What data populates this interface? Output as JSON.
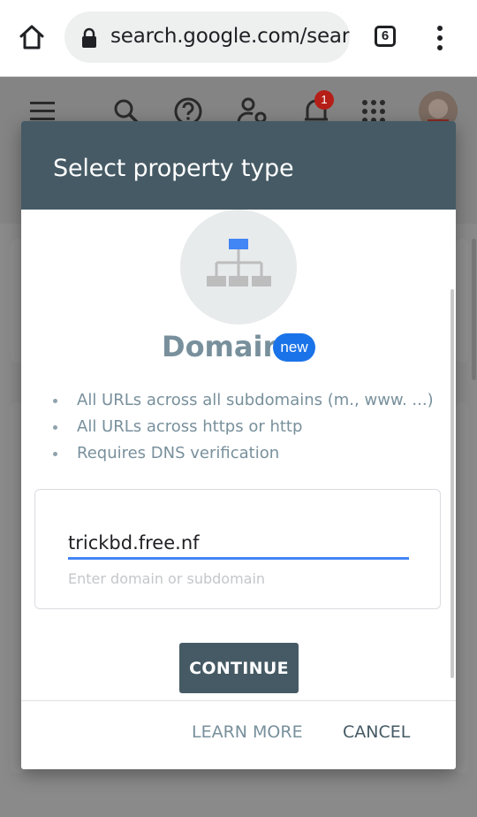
{
  "browser": {
    "url": "search.google.com/sear",
    "tab_count": "6"
  },
  "app_bar": {
    "notification_count": "1"
  },
  "dialog": {
    "title": "Select property type",
    "property_name": "Domain",
    "badge": "new",
    "bullets": [
      "All URLs across all subdomains (m., www. ...)",
      "All URLs across https or http",
      "Requires DNS verification"
    ],
    "input": {
      "value": "trickbd.free.nf",
      "hint": "Enter domain or subdomain"
    },
    "continue_label": "CONTINUE",
    "learn_more_label": "LEARN MORE",
    "cancel_label": "CANCEL"
  },
  "colors": {
    "header": "#455a64",
    "accent": "#4285f4",
    "badge": "#1a73e8",
    "muted_text": "#78909c"
  },
  "icons": [
    "home-icon",
    "lock-icon",
    "tabs-icon",
    "more-vert-icon",
    "menu-icon",
    "search-icon",
    "help-icon",
    "manage-users-icon",
    "bell-icon",
    "apps-icon",
    "avatar",
    "sitemap-icon"
  ]
}
